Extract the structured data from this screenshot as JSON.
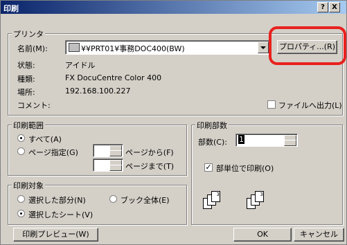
{
  "window": {
    "title": "印刷",
    "help_button": "?",
    "close_button": "X"
  },
  "printer": {
    "group_label": "プリンタ",
    "name_label": "名前(M):",
    "name_value": "¥¥PRT01¥事務DOC400(BW)",
    "properties_button": "プロパティ...(R)",
    "status_label": "状態:",
    "status_value": "アイドル",
    "type_label": "種類:",
    "type_value": "FX DocuCentre Color 400",
    "location_label": "場所:",
    "location_value": "192.168.100.227",
    "comment_label": "コメント:",
    "print_to_file_label": "ファイルへ出力(L)",
    "print_to_file_checked": false
  },
  "print_range": {
    "group_label": "印刷範囲",
    "all_label": "すべて(A)",
    "pages_label": "ページ指定(G)",
    "from_label": "ページから(F)",
    "to_label": "ページまで(T)",
    "from_value": "",
    "to_value": "",
    "selected": "all"
  },
  "copies": {
    "group_label": "印刷部数",
    "copies_label": "部数(C):",
    "copies_value": "1",
    "collate_label": "部単位で印刷(O)",
    "collate_checked": true
  },
  "print_target": {
    "group_label": "印刷対象",
    "selection_label": "選択した部分(N)",
    "entire_workbook_label": "ブック全体(E)",
    "active_sheet_label": "選択したシート(V)",
    "selected": "active_sheet"
  },
  "footer": {
    "preview_button": "印刷プレビュー(W)",
    "ok_button": "OK",
    "cancel_button": "キャンセル"
  },
  "annotation": {
    "highlight_color": "#e8211e"
  }
}
